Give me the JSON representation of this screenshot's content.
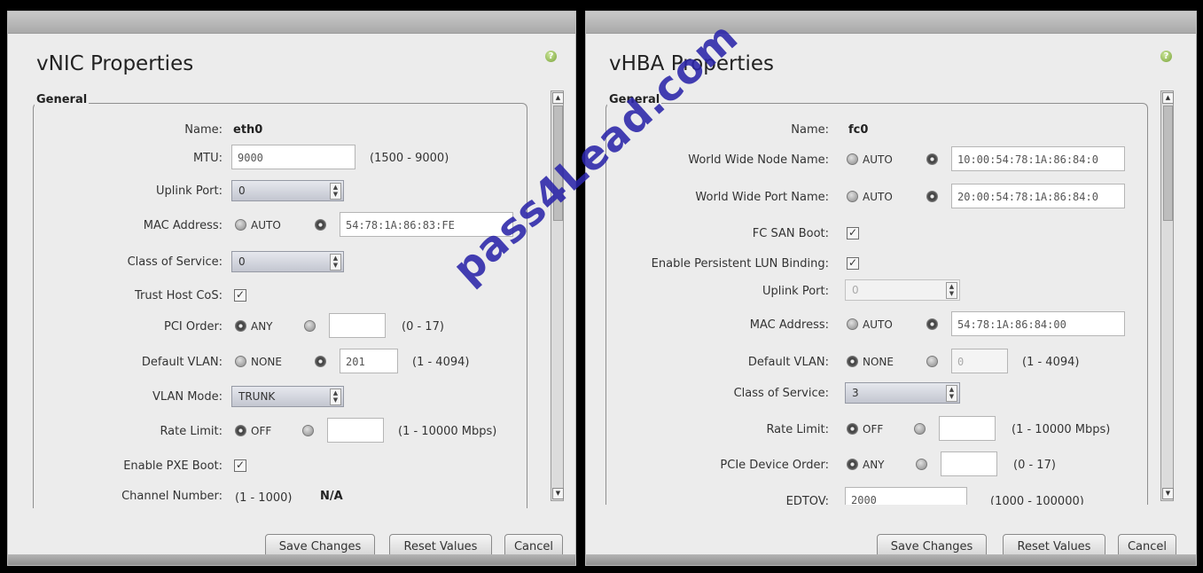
{
  "vnic": {
    "title": "vNIC Properties",
    "legend": "General",
    "name_label": "Name:",
    "name_value": "eth0",
    "mtu_label": "MTU:",
    "mtu_value": "9000",
    "mtu_range": "(1500 - 9000)",
    "uplink_label": "Uplink Port:",
    "uplink_value": "0",
    "mac_label": "MAC Address:",
    "mac_auto": "AUTO",
    "mac_value": "54:78:1A:86:83:FE",
    "cos_label": "Class of Service:",
    "cos_value": "0",
    "trust_label": "Trust Host CoS:",
    "pci_label": "PCI Order:",
    "pci_any": "ANY",
    "pci_value": "",
    "pci_range": "(0 - 17)",
    "vlan_label": "Default VLAN:",
    "vlan_none": "NONE",
    "vlan_value": "201",
    "vlan_range": "(1 - 4094)",
    "vlanmode_label": "VLAN Mode:",
    "vlanmode_value": "TRUNK",
    "rate_label": "Rate Limit:",
    "rate_off": "OFF",
    "rate_value": "",
    "rate_range": "(1 - 10000 Mbps)",
    "pxe_label": "Enable PXE Boot:",
    "channel_label": "Channel Number:",
    "channel_range": "(1 - 1000)",
    "channel_value": "N/A",
    "save": "Save Changes",
    "reset": "Reset Values",
    "cancel": "Cancel"
  },
  "vhba": {
    "title": "vHBA Properties",
    "legend": "General",
    "name_label": "Name:",
    "name_value": "fc0",
    "wwnn_label": "World Wide Node Name:",
    "wwnn_auto": "AUTO",
    "wwnn_value": "10:00:54:78:1A:86:84:0",
    "wwpn_label": "World Wide Port Name:",
    "wwpn_auto": "AUTO",
    "wwpn_value": "20:00:54:78:1A:86:84:0",
    "fcsan_label": "FC SAN Boot:",
    "lun_label": "Enable Persistent LUN Binding:",
    "uplink_label": "Uplink Port:",
    "uplink_value": "0",
    "mac_label": "MAC Address:",
    "mac_auto": "AUTO",
    "mac_value": "54:78:1A:86:84:00",
    "vlan_label": "Default VLAN:",
    "vlan_none": "NONE",
    "vlan_value": "0",
    "vlan_range": "(1 - 4094)",
    "cos_label": "Class of Service:",
    "cos_value": "3",
    "rate_label": "Rate Limit:",
    "rate_off": "OFF",
    "rate_value": "",
    "rate_range": "(1 - 10000 Mbps)",
    "pcie_label": "PCIe Device Order:",
    "pcie_any": "ANY",
    "pcie_value": "",
    "pcie_range": "(0 - 17)",
    "edtov_label": "EDTOV:",
    "edtov_value": "2000",
    "edtov_range": "(1000 - 100000)",
    "save": "Save Changes",
    "reset": "Reset Values",
    "cancel": "Cancel"
  },
  "watermark": "pass4Lead.com"
}
